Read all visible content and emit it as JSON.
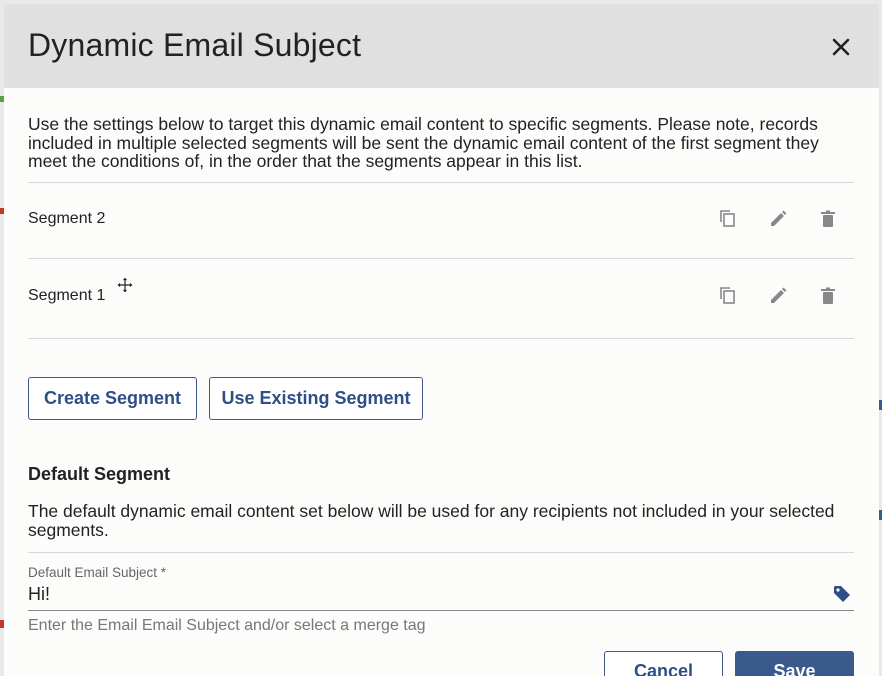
{
  "modal": {
    "title": "Dynamic Email Subject",
    "intro": "Use the settings below to target this dynamic email content to specific segments. Please note, records included in multiple selected segments will be sent the dynamic email content of the first segment they meet the conditions of, in the order that the segments appear in this list."
  },
  "segments": [
    {
      "label": "Segment 2",
      "icons": [
        "copy-icon",
        "edit-icon",
        "trash-icon"
      ]
    },
    {
      "label": "Segment 1",
      "icons": [
        "copy-icon",
        "edit-icon",
        "trash-icon"
      ]
    }
  ],
  "actions": {
    "create_segment": "Create Segment",
    "use_existing_segment": "Use Existing Segment"
  },
  "default_segment": {
    "heading": "Default Segment",
    "description": "The default dynamic email content set below will be used for any recipients not included in your selected segments.",
    "field_label": "Default Email Subject *",
    "field_value": "Hi!",
    "field_help": "Enter the Email Email Subject and/or select a merge tag",
    "merge_tag_icon": "tag-icon"
  },
  "footer": {
    "cancel": "Cancel",
    "save": "Save"
  },
  "colors": {
    "accent": "#3a5a8c",
    "header_bg": "#e0e0e0",
    "modal_bg": "#fcfcfb"
  }
}
